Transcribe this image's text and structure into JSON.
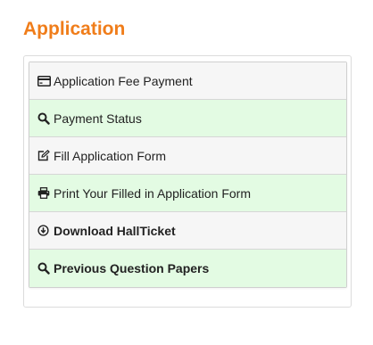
{
  "page": {
    "title": "Application"
  },
  "menu": {
    "items": [
      {
        "label": "Application Fee Payment",
        "icon": "credit-card-icon",
        "style": "gray",
        "bold": false
      },
      {
        "label": "Payment Status",
        "icon": "search-icon",
        "style": "green",
        "bold": false
      },
      {
        "label": "Fill Application Form",
        "icon": "edit-icon",
        "style": "gray",
        "bold": false
      },
      {
        "label": "Print Your Filled in Application Form",
        "icon": "print-icon",
        "style": "green",
        "bold": false
      },
      {
        "label": "Download HallTicket",
        "icon": "download-icon",
        "style": "gray",
        "bold": true
      },
      {
        "label": "Previous Question Papers",
        "icon": "search-icon",
        "style": "green",
        "bold": true
      }
    ]
  },
  "colors": {
    "title": "#f07d1a",
    "row_green": "#e3fbe3",
    "row_gray": "#f6f6f6"
  }
}
